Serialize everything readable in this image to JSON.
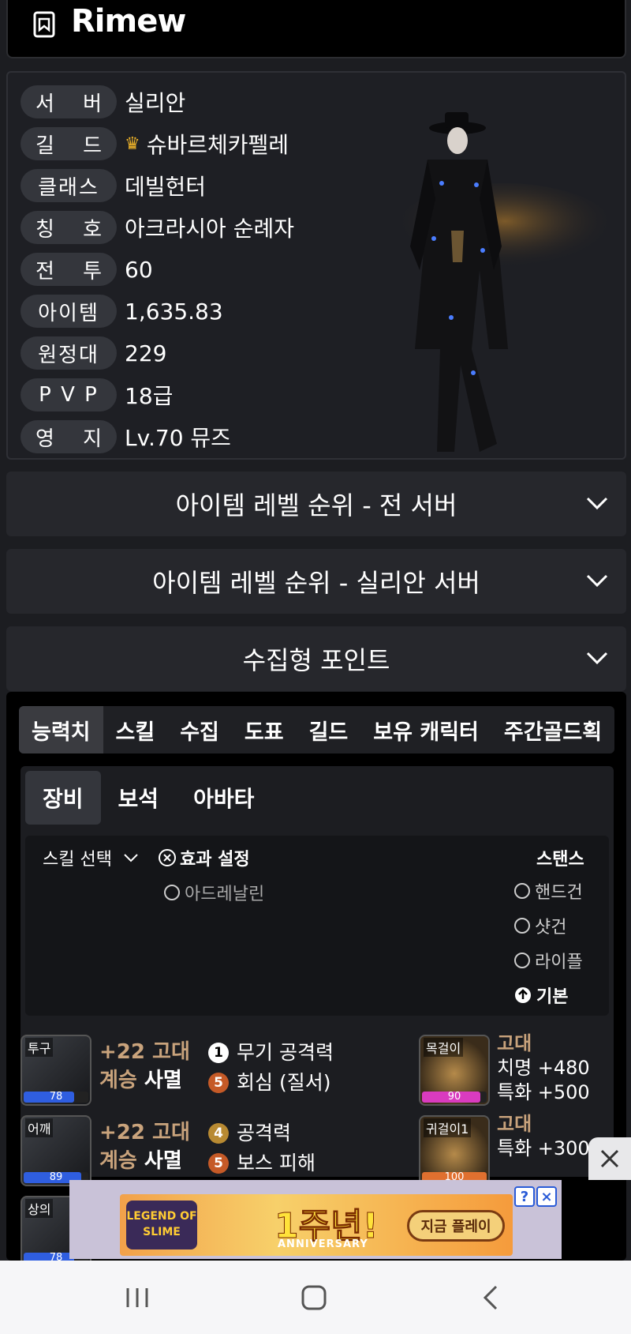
{
  "header": {
    "title": "Rimew",
    "logo_icon": "bookmark-icon"
  },
  "profile": {
    "rows": [
      {
        "label": "서 버",
        "value": "실리안"
      },
      {
        "label": "길 드",
        "value": "슈바르체카펠레",
        "icon": "crown-icon"
      },
      {
        "label": "클래스",
        "value": "데빌헌터"
      },
      {
        "label": "칭 호",
        "value": "아크라시아 순례자"
      },
      {
        "label": "전 투",
        "value": "60"
      },
      {
        "label": "아이템",
        "value": "1,635.83"
      },
      {
        "label": "원정대",
        "value": "229"
      },
      {
        "label": "P V P",
        "value": "18급"
      },
      {
        "label": "영 지",
        "value": "Lv.70 뮤즈"
      }
    ]
  },
  "sections": [
    {
      "title": "아이템 레벨 순위 - 전 서버"
    },
    {
      "title": "아이템 레벨 순위 - 실리안 서버"
    },
    {
      "title": "수집형 포인트"
    }
  ],
  "tabs": [
    "능력치",
    "스킬",
    "수집",
    "도표",
    "길드",
    "보유 캐릭터",
    "주간골드획"
  ],
  "subtabs": [
    "장비",
    "보석",
    "아바타"
  ],
  "options": {
    "skill_select": "스킬 선택",
    "effect_setting": "효과 설정",
    "adrenaline": "아드레날린",
    "stance_title": "스탠스",
    "stances": [
      "핸드건",
      "샷건",
      "라이플",
      "기본"
    ]
  },
  "equipment": [
    {
      "slot": "투구",
      "level": "78",
      "bar_color": "#2f5ee0",
      "fill": 0.78,
      "grade": "+22 고대",
      "set_prefix": "계승",
      "set_name": "사멸",
      "effects": [
        {
          "num": "1",
          "style": "white",
          "text": "무기 공격력"
        },
        {
          "num": "5",
          "style": "orange",
          "text": "회심 (질서)"
        }
      ],
      "acc": {
        "slot": "목걸이",
        "value": "90",
        "bar_color": "#d93bbf",
        "fill": 0.9,
        "grade": "고대",
        "lines": [
          "치명 +480",
          "특화 +500"
        ]
      }
    },
    {
      "slot": "어깨",
      "level": "89",
      "bar_color": "#2f5ee0",
      "fill": 0.89,
      "grade": "+22 고대",
      "set_prefix": "계승",
      "set_name": "사멸",
      "effects": [
        {
          "num": "4",
          "style": "gold",
          "text": "공격력"
        },
        {
          "num": "5",
          "style": "orange",
          "text": "보스 피해"
        }
      ],
      "acc": {
        "slot": "귀걸이1",
        "value": "100",
        "bar_color": "#e0702f",
        "fill": 1.0,
        "grade": "고대",
        "lines": [
          "특화 +300"
        ]
      }
    },
    {
      "slot": "상의",
      "level": "78",
      "bar_color": "#2f5ee0",
      "fill": 0.78
    }
  ],
  "ad": {
    "logo": "LEGEND OF SLIME",
    "headline": "1주년!",
    "subline": "ANNIVERSARY",
    "cta": "지금 플레이",
    "info_icon": "?",
    "close_icon": "×"
  },
  "navbar": {
    "recent_icon": "recent-apps-icon",
    "home_icon": "home-icon",
    "back_icon": "back-icon"
  }
}
